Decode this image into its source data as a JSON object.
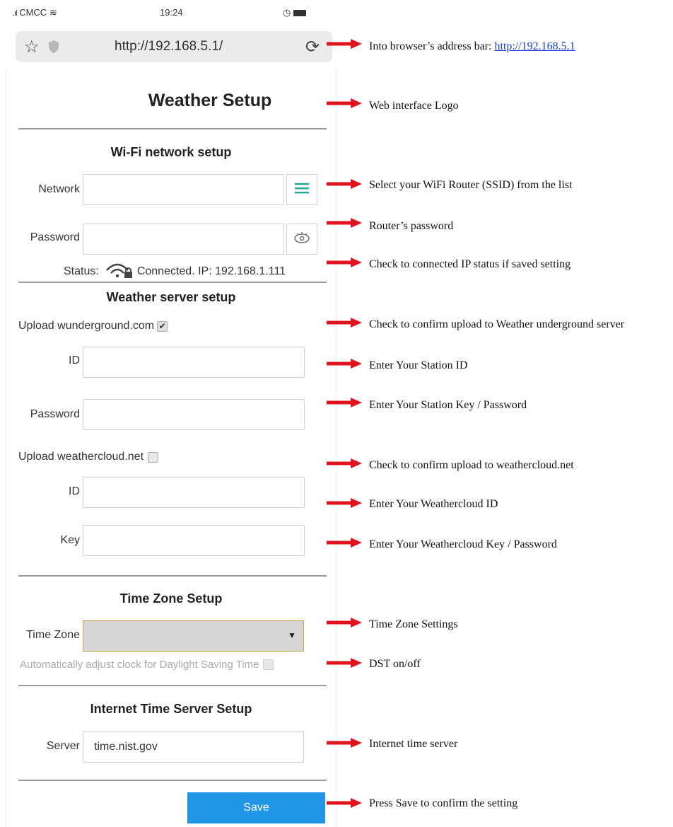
{
  "status_bar": {
    "carrier": "CMCC",
    "time": "19:24"
  },
  "browser": {
    "url": "http://192.168.5.1/"
  },
  "page": {
    "logo": "Weather Setup",
    "wifi": {
      "heading": "Wi-Fi network setup",
      "network_label": "Network",
      "network_value": "",
      "password_label": "Password",
      "password_value": "",
      "status_label": "Status:",
      "status_text": "Connected. IP: 192.168.1.111"
    },
    "weather": {
      "heading": "Weather server setup",
      "wu_label": "Upload wunderground.com",
      "wu_checked": true,
      "wu_id_label": "ID",
      "wu_password_label": "Password",
      "wc_label": "Upload weathercloud.net",
      "wc_checked": false,
      "wc_id_label": "ID",
      "wc_key_label": "Key"
    },
    "timezone": {
      "heading": "Time Zone Setup",
      "tz_label": "Time Zone",
      "tz_value": "",
      "dst_label": "Automatically adjust clock for Daylight Saving Time"
    },
    "ntp": {
      "heading": "Internet Time Server Setup",
      "server_label": "Server",
      "server_value": "time.nist.gov"
    },
    "save_label": "Save"
  },
  "annotations": {
    "address_bar_prefix": "Into browser’s address bar: ",
    "address_bar_link": "http://192.168.5.1",
    "logo": "Web interface Logo",
    "network": "Select your WiFi Router (SSID) from the list",
    "password": "Router’s password",
    "status": "Check to connected IP status if saved setting",
    "wu_upload": "Check to confirm upload to Weather underground server",
    "wu_id": "Enter Your Station ID",
    "wu_key": "Enter Your Station Key / Password",
    "wc_upload": "Check to confirm upload to weathercloud.net",
    "wc_id": "Enter Your Weathercloud ID",
    "wc_key": "Enter Your Weathercloud Key / Password",
    "timezone": "Time Zone Settings",
    "dst": "DST on/off",
    "ntp": "Internet time server",
    "save": "Press Save to confirm the setting"
  },
  "colors": {
    "accent": "#2196e6",
    "arrow": "#e0141e",
    "link": "#1a3fd6",
    "menu_icon": "#26a69a"
  }
}
